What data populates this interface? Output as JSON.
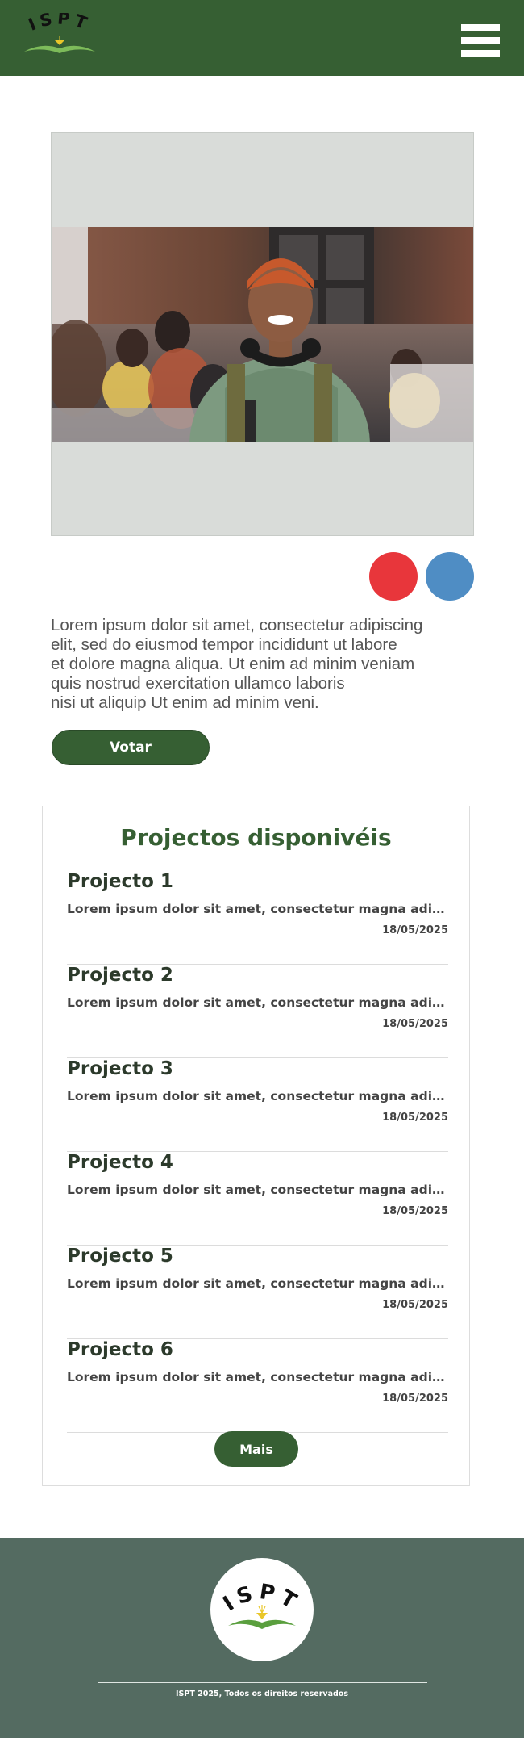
{
  "brand": {
    "logo_text": "ISPT",
    "color_primary": "#365f33",
    "color_footer": "#546b61",
    "color_red": "#e8363b",
    "color_blue": "#4f8dc4"
  },
  "header": {
    "menu_icon": "hamburger-menu-icon"
  },
  "hero": {
    "image_alt": "Smiling student with headphones holding a book in a classroom"
  },
  "intro": {
    "text": "Lorem ipsum dolor sit amet, consectetur adipiscing\nelit, sed do eiusmod tempor incididunt ut labore\net dolore magna aliqua. Ut enim ad minim veniam\nquis nostrud exercitation ullamco laboris\nnisi ut aliquip Ut enim ad minim veni."
  },
  "vote_button": {
    "label": "Votar"
  },
  "projects": {
    "title": "Projectos disponivéis",
    "items": [
      {
        "title": "Projecto 1",
        "description": "Lorem ipsum dolor sit amet, consectetur magna adipiscing elit",
        "date": "18/05/2025"
      },
      {
        "title": "Projecto 2",
        "description": "Lorem ipsum dolor sit amet, consectetur magna adipiscing elit",
        "date": "18/05/2025"
      },
      {
        "title": "Projecto 3",
        "description": "Lorem ipsum dolor sit amet, consectetur magna adipiscing elit",
        "date": "18/05/2025"
      },
      {
        "title": "Projecto 4",
        "description": "Lorem ipsum dolor sit amet, consectetur magna adipiscing elit",
        "date": "18/05/2025"
      },
      {
        "title": "Projecto 5",
        "description": "Lorem ipsum dolor sit amet, consectetur magna adipiscing elit",
        "date": "18/05/2025"
      },
      {
        "title": "Projecto 6",
        "description": "Lorem ipsum dolor sit amet, consectetur magna adipiscing elit",
        "date": "18/05/2025"
      }
    ],
    "more_label": "Mais"
  },
  "footer": {
    "logo_text": "ISPT",
    "copyright": "ISPT 2025, Todos os direitos reservados"
  }
}
